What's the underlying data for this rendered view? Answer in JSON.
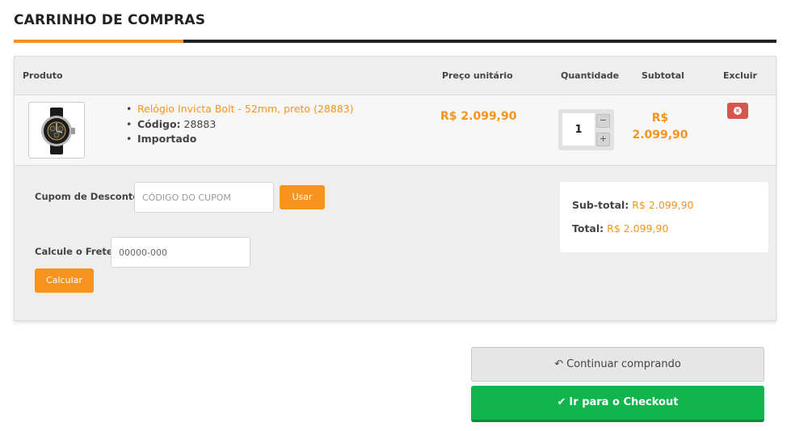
{
  "page": {
    "title": "CARRINHO DE COMPRAS"
  },
  "table": {
    "headers": {
      "produto": "Produto",
      "preco": "Preço unitário",
      "quantidade": "Quantidade",
      "subtotal": "Subtotal",
      "excluir": "Excluir"
    },
    "rows": [
      {
        "image_icon": "watch-image",
        "name": "Relógio Invicta Bolt - 52mm, preto (28883)",
        "code_label": "Código:",
        "code_value": "28883",
        "origin": "Importado",
        "unit_price": "R$ 2.099,90",
        "quantity": "1",
        "qty_minus": "−",
        "qty_plus": "+",
        "subtotal_currency": "R$",
        "subtotal_value": "2.099,90",
        "delete_icon": "times-circle-icon",
        "delete_glyph": "×"
      }
    ]
  },
  "coupon": {
    "label": "Cupom de Desconto:",
    "placeholder": "CÓDIGO DO CUPOM",
    "button": "Usar"
  },
  "shipping": {
    "label": "Calcule o Frete:",
    "placeholder": "00000-000",
    "button": "Calcular"
  },
  "summary": {
    "subtotal_label": "Sub-total:",
    "subtotal_value": "R$ 2.099,90",
    "total_label": "Total:",
    "total_value": "R$ 2.099,90"
  },
  "actions": {
    "continue_icon": "reply-icon",
    "continue_glyph": "↶",
    "continue_label": "Continuar comprando",
    "checkout_icon": "check-icon",
    "checkout_glyph": "✔",
    "checkout_label": "Ir para o Checkout"
  },
  "colors": {
    "accent": "#f7941d",
    "checkout": "#11b54d",
    "danger": "#d9534f"
  }
}
